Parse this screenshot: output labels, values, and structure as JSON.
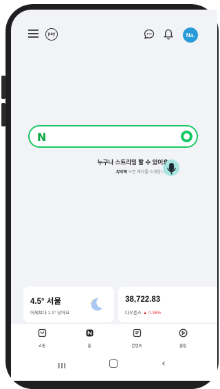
{
  "colors": {
    "accent_green": "#17c964",
    "avatar_blue": "#2a9bd9",
    "stock_down_red": "#e2383f",
    "screen_bg": "#f2f3f6"
  },
  "header": {
    "menu_icon": "hamburger-menu-icon",
    "pay_label": "pay",
    "chat_icon": "chat-bubble-icon",
    "bell_icon": "bell-icon",
    "avatar_initials": "Na."
  },
  "search": {
    "logo_letter": "N",
    "mic_icon": "green-lens-icon"
  },
  "banner": {
    "title": "누구나 스트리밍 할 수 있어요",
    "brand": "치지직",
    "subtitle": "오픈 베타를 소개합니다",
    "icon": "microphone-icon"
  },
  "cards": {
    "weather": {
      "temp_city": "4.5° 서울",
      "detail": "어제보다 1.1° 낮아요",
      "icon": "moon-icon"
    },
    "stock": {
      "value": "38,722.83",
      "index_name": "다우존스",
      "change": "▲ 0.36%"
    }
  },
  "bottom_nav": [
    {
      "label": "쇼핑",
      "icon": "shopping-bag-icon"
    },
    {
      "label": "홈",
      "icon": "home-icon"
    },
    {
      "label": "콘텐츠",
      "icon": "content-icon"
    },
    {
      "label": "클립",
      "icon": "clip-play-icon"
    }
  ],
  "system_nav": {
    "recent": "recent-apps-icon",
    "home": "system-home-icon",
    "back": "‹"
  }
}
